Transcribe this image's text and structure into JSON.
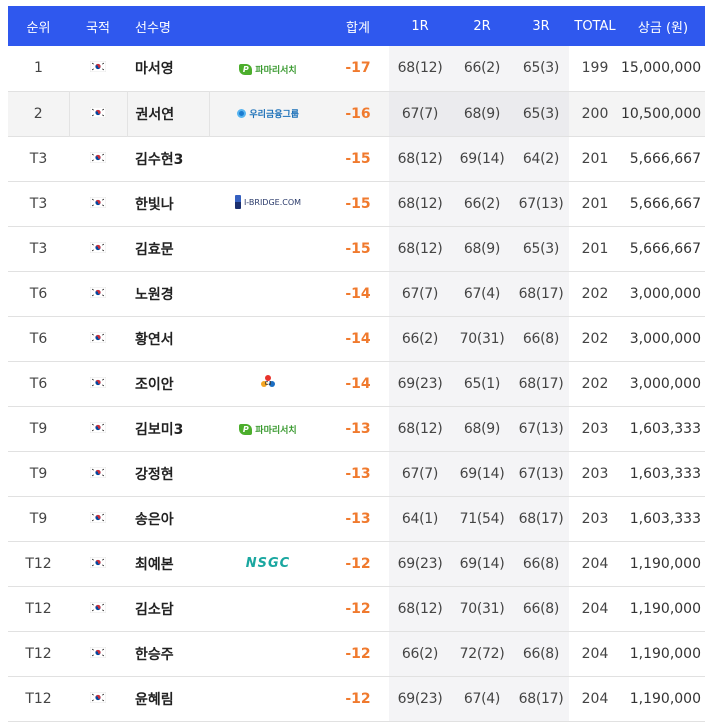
{
  "header": {
    "rank": "순위",
    "nation": "국적",
    "player": "선수명",
    "total": "합계",
    "r1": "1R",
    "r2": "2R",
    "r3": "3R",
    "strokes": "TOTAL",
    "prize": "상금 (원)"
  },
  "colors": {
    "header_bg": "#2f58ee",
    "score_accent": "#f07a2e",
    "highlight_row": "#f4f4f4"
  },
  "rows": [
    {
      "rank": "1",
      "flag": "korea-flag-icon",
      "name": "마서영",
      "sponsor": "파마리서치",
      "sponsor_logo": "pharmaresearch-logo",
      "total": "-17",
      "r1": "68(12)",
      "r2": "66(2)",
      "r3": "65(3)",
      "strokes": "199",
      "prize": "15,000,000"
    },
    {
      "rank": "2",
      "flag": "korea-flag-icon",
      "name": "권서연",
      "sponsor": "우리금융그룹",
      "sponsor_logo": "woori-logo",
      "total": "-16",
      "r1": "67(7)",
      "r2": "68(9)",
      "r3": "65(3)",
      "strokes": "200",
      "prize": "10,500,000"
    },
    {
      "rank": "T3",
      "flag": "korea-flag-icon",
      "name": "김수현3",
      "sponsor": "",
      "sponsor_logo": "",
      "total": "-15",
      "r1": "68(12)",
      "r2": "69(14)",
      "r3": "64(2)",
      "strokes": "201",
      "prize": "5,666,667"
    },
    {
      "rank": "T3",
      "flag": "korea-flag-icon",
      "name": "한빛나",
      "sponsor": "I-BRIDGE.COM",
      "sponsor_logo": "ibridge-logo",
      "total": "-15",
      "r1": "68(12)",
      "r2": "66(2)",
      "r3": "67(13)",
      "strokes": "201",
      "prize": "5,666,667"
    },
    {
      "rank": "T3",
      "flag": "korea-flag-icon",
      "name": "김효문",
      "sponsor": "",
      "sponsor_logo": "",
      "total": "-15",
      "r1": "68(12)",
      "r2": "68(9)",
      "r3": "65(3)",
      "strokes": "201",
      "prize": "5,666,667"
    },
    {
      "rank": "T6",
      "flag": "korea-flag-icon",
      "name": "노원경",
      "sponsor": "",
      "sponsor_logo": "",
      "total": "-14",
      "r1": "67(7)",
      "r2": "67(4)",
      "r3": "68(17)",
      "strokes": "202",
      "prize": "3,000,000"
    },
    {
      "rank": "T6",
      "flag": "korea-flag-icon",
      "name": "황연서",
      "sponsor": "",
      "sponsor_logo": "",
      "total": "-14",
      "r1": "66(2)",
      "r2": "70(31)",
      "r3": "66(8)",
      "strokes": "202",
      "prize": "3,000,000"
    },
    {
      "rank": "T6",
      "flag": "korea-flag-icon",
      "name": "조이안",
      "sponsor": "CJ",
      "sponsor_logo": "cj-logo",
      "total": "-14",
      "r1": "69(23)",
      "r2": "65(1)",
      "r3": "68(17)",
      "strokes": "202",
      "prize": "3,000,000"
    },
    {
      "rank": "T9",
      "flag": "korea-flag-icon",
      "name": "김보미3",
      "sponsor": "파마리서치",
      "sponsor_logo": "pharmaresearch-logo",
      "total": "-13",
      "r1": "68(12)",
      "r2": "68(9)",
      "r3": "67(13)",
      "strokes": "203",
      "prize": "1,603,333"
    },
    {
      "rank": "T9",
      "flag": "korea-flag-icon",
      "name": "강정현",
      "sponsor": "",
      "sponsor_logo": "",
      "total": "-13",
      "r1": "67(7)",
      "r2": "69(14)",
      "r3": "67(13)",
      "strokes": "203",
      "prize": "1,603,333"
    },
    {
      "rank": "T9",
      "flag": "korea-flag-icon",
      "name": "송은아",
      "sponsor": "",
      "sponsor_logo": "",
      "total": "-13",
      "r1": "64(1)",
      "r2": "71(54)",
      "r3": "68(17)",
      "strokes": "203",
      "prize": "1,603,333"
    },
    {
      "rank": "T12",
      "flag": "korea-flag-icon",
      "name": "최예본",
      "sponsor": "NSGC",
      "sponsor_logo": "nsgc-logo",
      "total": "-12",
      "r1": "69(23)",
      "r2": "69(14)",
      "r3": "66(8)",
      "strokes": "204",
      "prize": "1,190,000"
    },
    {
      "rank": "T12",
      "flag": "korea-flag-icon",
      "name": "김소담",
      "sponsor": "",
      "sponsor_logo": "",
      "total": "-12",
      "r1": "68(12)",
      "r2": "70(31)",
      "r3": "66(8)",
      "strokes": "204",
      "prize": "1,190,000"
    },
    {
      "rank": "T12",
      "flag": "korea-flag-icon",
      "name": "한승주",
      "sponsor": "",
      "sponsor_logo": "",
      "total": "-12",
      "r1": "66(2)",
      "r2": "72(72)",
      "r3": "66(8)",
      "strokes": "204",
      "prize": "1,190,000"
    },
    {
      "rank": "T12",
      "flag": "korea-flag-icon",
      "name": "윤혜림",
      "sponsor": "",
      "sponsor_logo": "",
      "total": "-12",
      "r1": "69(23)",
      "r2": "67(4)",
      "r3": "68(17)",
      "strokes": "204",
      "prize": "1,190,000"
    }
  ]
}
